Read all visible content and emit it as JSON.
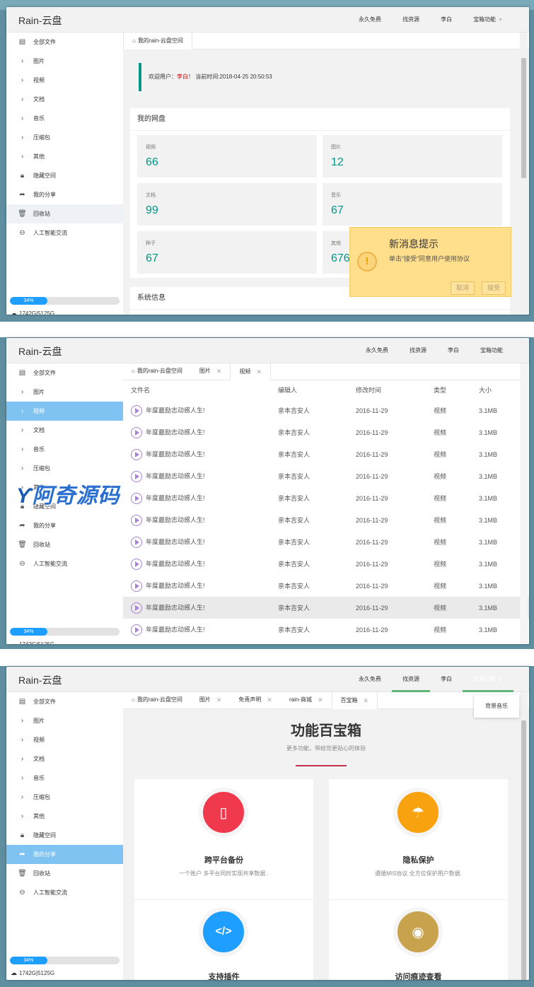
{
  "app": {
    "title": "Rain-云盘"
  },
  "nav": [
    {
      "label": "永久免费"
    },
    {
      "label": "找资源"
    },
    {
      "label": "李白"
    },
    {
      "label": "宝箱功能"
    }
  ],
  "sidebar": {
    "items": [
      {
        "label": "全部文件",
        "icon": "file-icon"
      },
      {
        "label": "图片",
        "icon": "chevron-right-icon"
      },
      {
        "label": "视频",
        "icon": "chevron-right-icon"
      },
      {
        "label": "文档",
        "icon": "chevron-right-icon"
      },
      {
        "label": "音乐",
        "icon": "chevron-right-icon"
      },
      {
        "label": "压缩包",
        "icon": "chevron-right-icon"
      },
      {
        "label": "其他",
        "icon": "chevron-right-icon"
      },
      {
        "label": "隐藏空间",
        "icon": "lock-icon"
      },
      {
        "label": "我的分享",
        "icon": "share-icon"
      },
      {
        "label": "回收站",
        "icon": "trash-icon"
      },
      {
        "label": "人工智能交流",
        "icon": "chat-icon"
      }
    ],
    "quota_percent": "34%",
    "quota_fraction": 0.34,
    "quota_text": "1742G|5125G"
  },
  "screen1": {
    "tab": "我的rain-云盘空间",
    "welcome_prefix": "欢迎用户：",
    "welcome_user": "李白",
    "welcome_suffix": "！ 当前时间:2018-04-25 20:50:53",
    "my_disk_title": "我的网盘",
    "stats": [
      {
        "label": "视频",
        "value": "66"
      },
      {
        "label": "图片",
        "value": "12"
      },
      {
        "label": "文档",
        "value": "99"
      },
      {
        "label": "音乐",
        "value": "67"
      },
      {
        "label": "种子",
        "value": "67"
      },
      {
        "label": "其他",
        "value": "676"
      }
    ],
    "sysinfo_title": "系统信息",
    "toast": {
      "title": "新消息提示",
      "message": "单击“接受”同意用户使用协议",
      "cancel": "取消",
      "accept": "接受"
    }
  },
  "screen2": {
    "tabs": [
      {
        "label": "我的rain-云盘空间"
      },
      {
        "label": "图片"
      },
      {
        "label": "视频"
      }
    ],
    "columns": [
      "文件名",
      "编辑人",
      "修改时间",
      "类型",
      "大小"
    ],
    "rows": [
      [
        "年度最励志动感人生!",
        "亲本吉安人",
        "2016-11-29",
        "视频",
        "3.1MB"
      ],
      [
        "年度最励志动感人生!",
        "亲本吉安人",
        "2016-11-29",
        "视频",
        "3.1MB"
      ],
      [
        "年度最励志动感人生!",
        "亲本吉安人",
        "2016-11-29",
        "视频",
        "3.1MB"
      ],
      [
        "年度最励志动感人生!",
        "亲本吉安人",
        "2016-11-29",
        "视频",
        "3.1MB"
      ],
      [
        "年度最励志动感人生!",
        "亲本吉安人",
        "2016-11-29",
        "视频",
        "3.1MB"
      ],
      [
        "年度最励志动感人生!",
        "亲本吉安人",
        "2016-11-29",
        "视频",
        "3.1MB"
      ],
      [
        "年度最励志动感人生!",
        "亲本吉安人",
        "2016-11-29",
        "视频",
        "3.1MB"
      ],
      [
        "年度最励志动感人生!",
        "亲本吉安人",
        "2016-11-29",
        "视频",
        "3.1MB"
      ],
      [
        "年度最励志动感人生!",
        "亲本吉安人",
        "2016-11-29",
        "视频",
        "3.1MB"
      ],
      [
        "年度最励志动感人生!",
        "亲本吉安人",
        "2016-11-29",
        "视频",
        "3.1MB"
      ],
      [
        "年度最励志动感人生!",
        "亲本吉安人",
        "2016-11-29",
        "视频",
        "3.1MB"
      ]
    ],
    "watermark": "阿奇源码"
  },
  "screen3": {
    "tabs": [
      {
        "label": "我的rain-云盘空间"
      },
      {
        "label": "图片"
      },
      {
        "label": "免责声明"
      },
      {
        "label": "rain-商城"
      },
      {
        "label": "百宝箱"
      }
    ],
    "dropdown_item": "背景音乐",
    "heading": "功能百宝箱",
    "subheading": "更多功能，带给您更贴心的体验",
    "features": [
      {
        "title": "跨平台备份",
        "desc": "一个账户 多平台同时实现共享数据 .",
        "color": "#f0394d",
        "icon": "tablet-icon"
      },
      {
        "title": "隐私保护",
        "desc": "遵循MIS协议 全方位保护用户数据.",
        "color": "#f7a20e",
        "icon": "umbrella-icon"
      },
      {
        "title": "支持插件",
        "desc": "",
        "color": "#1e9fff",
        "icon": "code-icon"
      },
      {
        "title": "访问痕迹查看",
        "desc": "",
        "color": "#c9a24e",
        "icon": "eye-icon"
      }
    ]
  },
  "colors": {
    "accent": "#009688",
    "selected": "#7ec3f2",
    "progress": "#1e9fff",
    "toast": "#ffde8c"
  }
}
